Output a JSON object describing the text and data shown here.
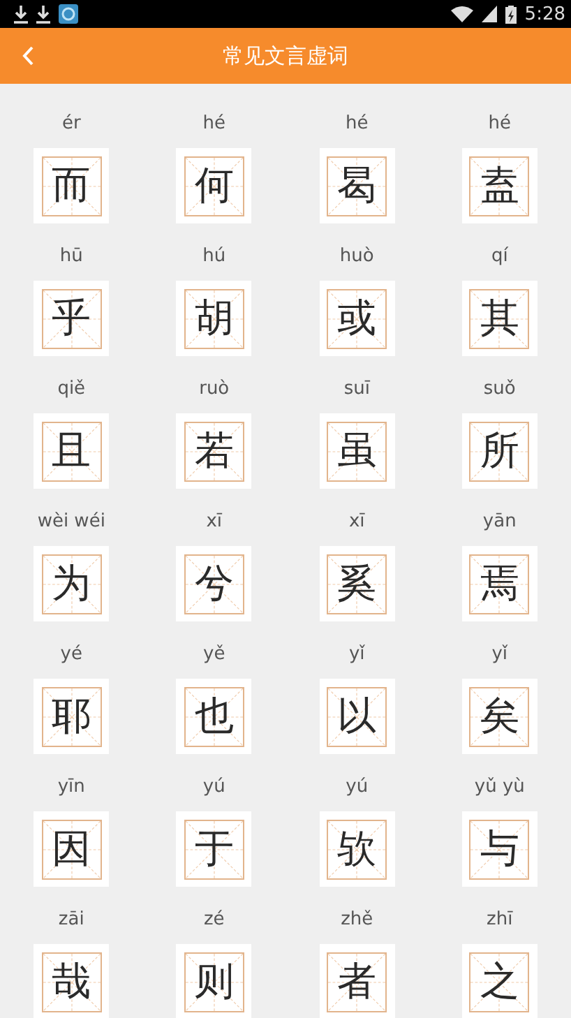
{
  "status_bar": {
    "time": "5:28"
  },
  "header": {
    "title": "常见文言虚词"
  },
  "words": [
    {
      "pinyin": "ér",
      "char": "而"
    },
    {
      "pinyin": "hé",
      "char": "何"
    },
    {
      "pinyin": "hé",
      "char": "曷"
    },
    {
      "pinyin": "hé",
      "char": "盍"
    },
    {
      "pinyin": "hū",
      "char": "乎"
    },
    {
      "pinyin": "hú",
      "char": "胡"
    },
    {
      "pinyin": "huò",
      "char": "或"
    },
    {
      "pinyin": "qí",
      "char": "其"
    },
    {
      "pinyin": "qiě",
      "char": "且"
    },
    {
      "pinyin": "ruò",
      "char": "若"
    },
    {
      "pinyin": "suī",
      "char": "虽"
    },
    {
      "pinyin": "suǒ",
      "char": "所"
    },
    {
      "pinyin": "wèi wéi",
      "char": "为"
    },
    {
      "pinyin": "xī",
      "char": "兮"
    },
    {
      "pinyin": "xī",
      "char": "奚"
    },
    {
      "pinyin": "yān",
      "char": "焉"
    },
    {
      "pinyin": "yé",
      "char": "耶"
    },
    {
      "pinyin": "yě",
      "char": "也"
    },
    {
      "pinyin": "yǐ",
      "char": "以"
    },
    {
      "pinyin": "yǐ",
      "char": "矣"
    },
    {
      "pinyin": "yīn",
      "char": "因"
    },
    {
      "pinyin": "yú",
      "char": "于"
    },
    {
      "pinyin": "yú",
      "char": "欤"
    },
    {
      "pinyin": "yǔ yù",
      "char": "与"
    },
    {
      "pinyin": "zāi",
      "char": "哉"
    },
    {
      "pinyin": "zé",
      "char": "则"
    },
    {
      "pinyin": "zhě",
      "char": "者"
    },
    {
      "pinyin": "zhī",
      "char": "之"
    }
  ]
}
